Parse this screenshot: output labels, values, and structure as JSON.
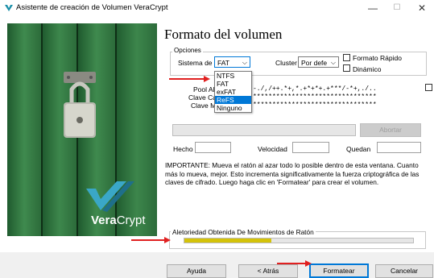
{
  "window": {
    "title": "Asistente de creación de Volumen VeraCrypt",
    "minimize": "—",
    "maximize": "☐",
    "close": "✕"
  },
  "brand": {
    "logo_text_1": "Vera",
    "logo_text_2": "Crypt"
  },
  "heading": "Formato del volumen",
  "options": {
    "group_label": "Opciones",
    "filesystem_label": "Sistema de",
    "filesystem_value": "FAT",
    "cluster_label": "Cluster",
    "cluster_value": "Por defe",
    "quick_format_label": "Formato Rápido",
    "dynamic_label": "Dinámico"
  },
  "filesystem_options": [
    "NTFS",
    "FAT",
    "exFAT",
    "ReFS",
    "Ninguno"
  ],
  "filesystem_highlighted": "ReFS",
  "keys": {
    "pool_label": "Pool Al",
    "pool_value": "-./,/++.*+,*.+*+*+.+***/-*+,./..",
    "header_key_label": "Clave Ca",
    "header_key_value": "********************************",
    "master_key_label": "Clave M",
    "master_key_value": "********************************"
  },
  "progress": {
    "abort_label": "Abortar",
    "done_label": "Hecho",
    "speed_label": "Velocidad",
    "left_label": "Quedan"
  },
  "info_text": "IMPORTANTE: Mueva el ratón al azar todo lo posible dentro de esta ventana. Cuanto más lo mueva, mejor. Esto incrementa significativamente la fuerza criptográfica de las claves de cifrado. Luego haga clic en 'Formatear' para crear el volumen.",
  "randomness": {
    "label": "Aletoriedad Obtenida De Movimientos de Ratón",
    "fill_fraction": 0.38
  },
  "buttons": {
    "help": "Ayuda",
    "back": "< Atrás",
    "format": "Formatear",
    "cancel": "Cancelar"
  },
  "colors": {
    "accent": "#0078d7",
    "annotation": "#e02020",
    "progress_fill": "#d4c30a"
  }
}
